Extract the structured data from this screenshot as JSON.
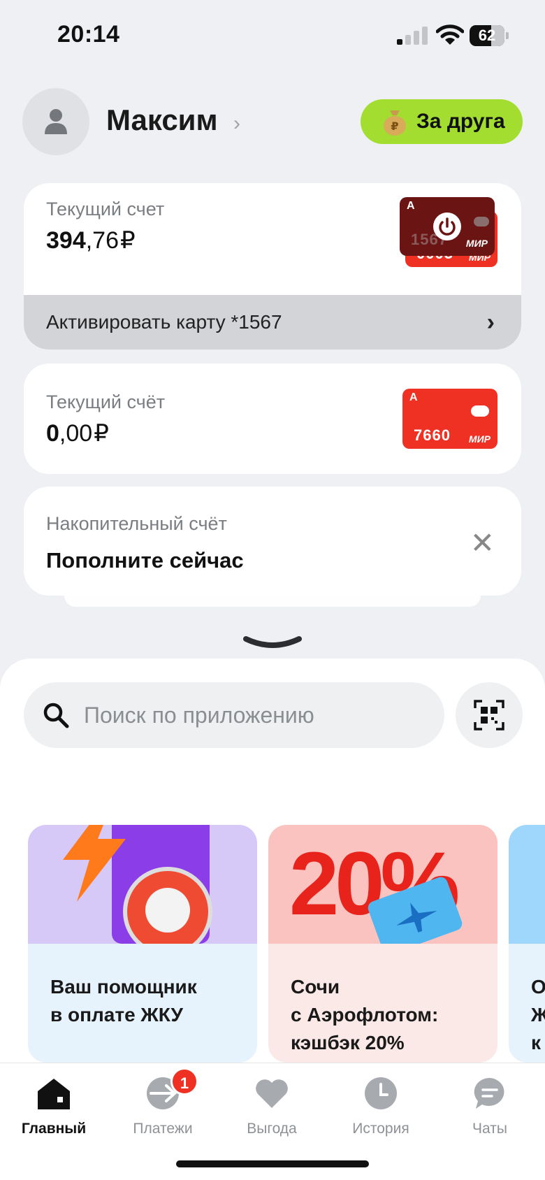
{
  "status_bar": {
    "time": "20:14",
    "battery": "62",
    "battery_fraction": 0.62,
    "icons": [
      "cellular-signal-icon",
      "wifi-icon",
      "battery-icon"
    ]
  },
  "header": {
    "user_name": "Максим",
    "invite_button_label": "За друга",
    "invite_icon": "money-bag-icon"
  },
  "accounts": [
    {
      "label": "Текущий счет",
      "amount_int": "394",
      "amount_frac": ",76",
      "currency": "₽",
      "cards": [
        {
          "number": "1567",
          "network": "МИР",
          "state": "inactive"
        },
        {
          "number": "0003",
          "network": "МИР",
          "state": "active"
        }
      ],
      "action_label": "Активировать карту *1567"
    },
    {
      "label": "Текущий счёт",
      "amount_int": "0",
      "amount_frac": ",00",
      "currency": "₽",
      "cards": [
        {
          "number": "7660",
          "network": "МИР",
          "state": "active"
        }
      ]
    },
    {
      "label": "Накопительный счёт",
      "title": "Пополните сейчас"
    }
  ],
  "search": {
    "placeholder": "Поиск по приложению"
  },
  "promos": [
    {
      "line1": "Ваш помощник",
      "line2": "в оплате ЖКУ",
      "line3": ""
    },
    {
      "line1": "Сочи",
      "line2": "с Аэрофлотом:",
      "line3": "кэшбэк 20%",
      "badge_text": "20%"
    },
    {
      "line1": "О",
      "line2": "Ж",
      "line3": "к"
    }
  ],
  "tabbar": {
    "items": [
      {
        "label": "Главный",
        "icon": "home-icon",
        "active": true
      },
      {
        "label": "Платежи",
        "icon": "payments-icon",
        "badge": "1"
      },
      {
        "label": "Выгода",
        "icon": "heart-icon"
      },
      {
        "label": "История",
        "icon": "clock-icon"
      },
      {
        "label": "Чаты",
        "icon": "chat-icon"
      }
    ]
  },
  "colors": {
    "accent_green": "#a3dd30",
    "brand_red": "#ef3124",
    "dark_red_card": "#6b1414"
  }
}
